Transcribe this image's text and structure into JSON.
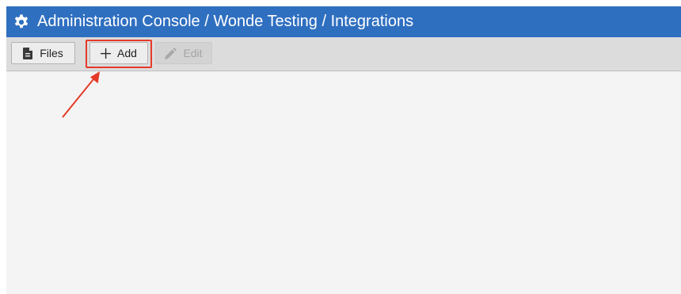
{
  "titlebar": {
    "title": "Administration Console / Wonde Testing / Integrations",
    "icon": "gear-icon",
    "background_color": "#2f6fc0"
  },
  "toolbar": {
    "files_label": "Files",
    "files_icon": "file-icon",
    "add_label": "Add",
    "add_icon": "plus-icon",
    "edit_label": "Edit",
    "edit_icon": "pencil-icon",
    "edit_state": "disabled"
  },
  "annotation": {
    "target": "add-button",
    "color": "#e53a28"
  }
}
